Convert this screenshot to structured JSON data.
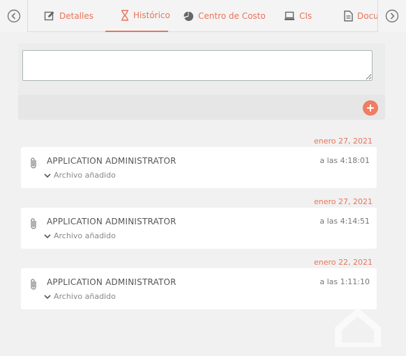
{
  "tabs": [
    {
      "label": "Detalles",
      "icon": "edit-icon"
    },
    {
      "label": "Histórico",
      "icon": "hourglass-icon",
      "active": true
    },
    {
      "label": "Centro de Costo",
      "icon": "pie-chart-icon"
    },
    {
      "label": "CIs",
      "icon": "laptop-icon"
    },
    {
      "label": "Documentos",
      "icon": "document-icon"
    }
  ],
  "compose": {
    "placeholder": "",
    "add_label": "+"
  },
  "entries": [
    {
      "date": "enero 27, 2021",
      "user": "APPLICATION ADMINISTRATOR",
      "time": "a las 4:18:01",
      "action": "Archivo añadido"
    },
    {
      "date": "enero 27, 2021",
      "user": "APPLICATION ADMINISTRATOR",
      "time": "a las 4:14:51",
      "action": "Archivo añadido"
    },
    {
      "date": "enero 22, 2021",
      "user": "APPLICATION ADMINISTRATOR",
      "time": "a las 1:11:10",
      "action": "Archivo añadido"
    }
  ],
  "colors": {
    "accent": "#e8745a",
    "background": "#f1f1f1"
  }
}
